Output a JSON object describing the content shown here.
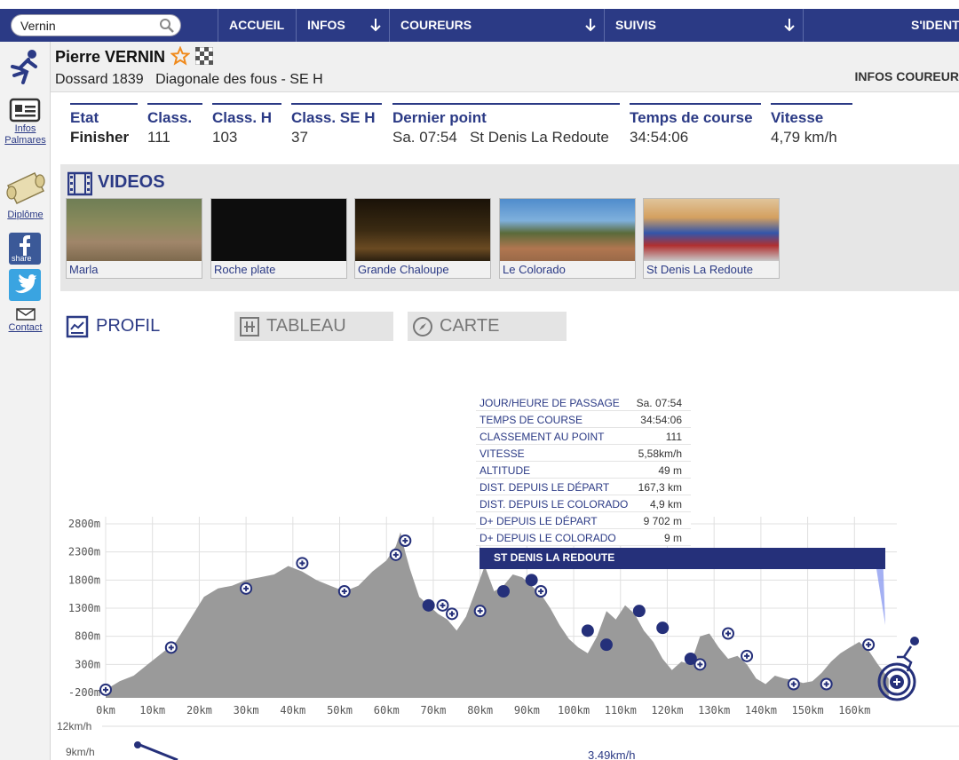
{
  "search": {
    "value": "Vernin"
  },
  "nav": {
    "items": [
      {
        "label": "ACCUEIL",
        "arrow": false
      },
      {
        "label": "INFOS",
        "arrow": true
      },
      {
        "label": "COUREURS",
        "arrow": true
      },
      {
        "label": "SUIVIS",
        "arrow": true
      },
      {
        "label": "S'IDENTI",
        "arrow": false
      }
    ]
  },
  "sidebar": {
    "infos_line1": "Infos",
    "infos_line2": "Palmares",
    "diplome": "Diplôme",
    "facebook": "share",
    "contact": "Contact"
  },
  "runner": {
    "name": "Pierre VERNIN",
    "dossard": "Dossard 1839",
    "race": "Diagonale des fous - SE H",
    "infos_coureur": "INFOS COUREUR"
  },
  "stats": [
    {
      "label": "Etat",
      "value": "Finisher"
    },
    {
      "label": "Class.",
      "value": "111"
    },
    {
      "label": "Class. H",
      "value": "103"
    },
    {
      "label": "Class. SE H",
      "value": "37"
    },
    {
      "label": "Dernier point",
      "value": "Sa. 07:54   St Denis La Redoute"
    },
    {
      "label": "Temps de course",
      "value": "34:54:06"
    },
    {
      "label": "Vitesse",
      "value": "4,79 km/h"
    }
  ],
  "videos": {
    "title": "VIDEOS",
    "items": [
      "Marla",
      "Roche plate",
      "Grande Chaloupe",
      "Le Colorado",
      "St Denis La Redoute"
    ]
  },
  "tabs": [
    "PROFIL",
    "TABLEAU",
    "CARTE"
  ],
  "tooltip": {
    "rows": [
      {
        "k": "JOUR/HEURE DE PASSAGE",
        "v": "Sa. 07:54"
      },
      {
        "k": "TEMPS DE COURSE",
        "v": "34:54:06"
      },
      {
        "k": "CLASSEMENT AU POINT",
        "v": "111"
      },
      {
        "k": "VITESSE",
        "v": "5,58km/h"
      },
      {
        "k": "ALTITUDE",
        "v": "49 m"
      },
      {
        "k": "DIST. DEPUIS LE DÉPART",
        "v": "167,3 km"
      },
      {
        "k": "DIST. DEPUIS LE COLORADO",
        "v": "4,9 km"
      },
      {
        "k": "D+ DEPUIS LE DÉPART",
        "v": "9 702 m"
      },
      {
        "k": "D+ DEPUIS LE COLORADO",
        "v": "9 m"
      }
    ],
    "point_name": "ST DENIS LA REDOUTE"
  },
  "colors": {
    "nav": "#2b3a85",
    "accent": "#25307a",
    "profile_fill": "#9a9a9a",
    "marker": "#25307a"
  },
  "chart_data": {
    "type": "area",
    "xlabel": "",
    "ylabel": "",
    "x_ticks": [
      "0km",
      "10km",
      "20km",
      "30km",
      "40km",
      "50km",
      "60km",
      "70km",
      "80km",
      "90km",
      "100km",
      "110km",
      "120km",
      "130km",
      "140km",
      "150km",
      "160km"
    ],
    "y_ticks": [
      "-200m",
      "300m",
      "800m",
      "1300m",
      "1800m",
      "2300m",
      "2800m"
    ],
    "xlim": [
      0,
      170
    ],
    "ylim": [
      -200,
      2800
    ],
    "grid": true,
    "series": [
      {
        "x": [
          0,
          3,
          6,
          9,
          12,
          15,
          18,
          21,
          24,
          27,
          30,
          33,
          36,
          39,
          42,
          45,
          48,
          51,
          54,
          57,
          60,
          62,
          63,
          64,
          65,
          67,
          69,
          71,
          73,
          75,
          77,
          79,
          81,
          83,
          85,
          87,
          89,
          91,
          93,
          95,
          97,
          99,
          101,
          103,
          105,
          107,
          109,
          111,
          113,
          115,
          117,
          119,
          121,
          123,
          125,
          127,
          129,
          131,
          133,
          135,
          137,
          139,
          141,
          143,
          145,
          147,
          149,
          151,
          153,
          155,
          157,
          159,
          161,
          163,
          165,
          167.3
        ],
        "y": [
          -150,
          0,
          100,
          300,
          500,
          700,
          1100,
          1500,
          1650,
          1700,
          1800,
          1850,
          1900,
          2050,
          1950,
          1800,
          1700,
          1600,
          1700,
          1950,
          2150,
          2400,
          2650,
          2300,
          2000,
          1500,
          1350,
          1200,
          1100,
          900,
          1150,
          1600,
          2050,
          1600,
          1700,
          1900,
          1850,
          1700,
          1550,
          1300,
          1000,
          750,
          600,
          500,
          800,
          1250,
          1100,
          1350,
          1200,
          900,
          700,
          400,
          200,
          350,
          300,
          800,
          850,
          600,
          400,
          450,
          300,
          50,
          -50,
          100,
          50,
          20,
          -30,
          0,
          150,
          350,
          500,
          600,
          700,
          550,
          300,
          49
        ]
      }
    ],
    "checkpoint_marks": [
      {
        "x": 0,
        "y": -150,
        "style": "plus"
      },
      {
        "x": 14,
        "y": 600,
        "style": "plus"
      },
      {
        "x": 30,
        "y": 1650,
        "style": "plus"
      },
      {
        "x": 42,
        "y": 2100,
        "style": "plus"
      },
      {
        "x": 51,
        "y": 1600,
        "style": "plus"
      },
      {
        "x": 62,
        "y": 2250,
        "style": "plus"
      },
      {
        "x": 64,
        "y": 2500,
        "style": "plus"
      },
      {
        "x": 69,
        "y": 1350,
        "style": "dot"
      },
      {
        "x": 72,
        "y": 1350,
        "style": "plus"
      },
      {
        "x": 74,
        "y": 1200,
        "style": "plus"
      },
      {
        "x": 80,
        "y": 1250,
        "style": "plus"
      },
      {
        "x": 85,
        "y": 1600,
        "style": "dot"
      },
      {
        "x": 91,
        "y": 1800,
        "style": "dot"
      },
      {
        "x": 93,
        "y": 1600,
        "style": "plus"
      },
      {
        "x": 103,
        "y": 900,
        "style": "dot"
      },
      {
        "x": 107,
        "y": 650,
        "style": "dot"
      },
      {
        "x": 114,
        "y": 1250,
        "style": "dot"
      },
      {
        "x": 119,
        "y": 950,
        "style": "dot"
      },
      {
        "x": 125,
        "y": 400,
        "style": "dot"
      },
      {
        "x": 127,
        "y": 300,
        "style": "plus"
      },
      {
        "x": 133,
        "y": 850,
        "style": "plus"
      },
      {
        "x": 137,
        "y": 450,
        "style": "plus"
      },
      {
        "x": 147,
        "y": -50,
        "style": "plus"
      },
      {
        "x": 154,
        "y": -50,
        "style": "plus"
      },
      {
        "x": 163,
        "y": 650,
        "style": "plus"
      }
    ],
    "speed_panel": {
      "y_ticks": [
        "12km/h",
        "9km/h"
      ],
      "label": "3.49km/h"
    }
  }
}
